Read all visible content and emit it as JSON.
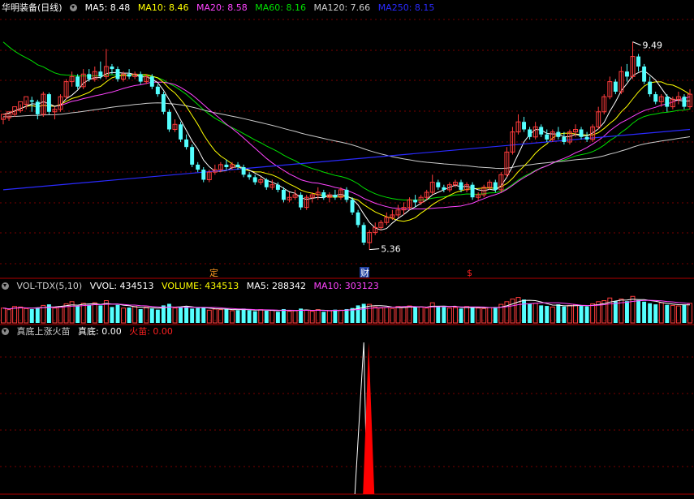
{
  "colors": {
    "up": "#ff3c3c",
    "down": "#54ffff",
    "ma5": "#ffffff",
    "ma10": "#ffff00",
    "ma20": "#ff44ff",
    "ma60": "#00e000",
    "ma120": "#cccccc",
    "ma250": "#2a2aff",
    "grid": "#7a0000",
    "axis": "#b00000"
  },
  "header_price": {
    "stock": "华明装备",
    "period": "(日线)",
    "ma5": "MA5: 8.48",
    "ma10": "MA10: 8.46",
    "ma20": "MA20: 8.58",
    "ma60": "MA60: 8.16",
    "ma120": "MA120: 7.66",
    "ma250": "MA250: 8.15"
  },
  "header_volume": {
    "name": "VOL-TDX(5,10)",
    "vvol": "VVOL: 434513",
    "volume": "VOLUME: 434513",
    "ma5": "MA5: 288342",
    "ma10": "MA10: 303123"
  },
  "header_indicator": {
    "name": "真底上涨火苗",
    "zhendi": "真底: 0.00",
    "huomiao": "火苗: 0.00"
  },
  "markers": {
    "ding": "定",
    "cai": "财",
    "dollar": "$"
  },
  "chart_data": [
    {
      "type": "candlestick",
      "title": "华明装备 (日线)",
      "annotations": [
        {
          "label": "9.49",
          "kind": "high"
        },
        {
          "label": "5.36",
          "kind": "low"
        }
      ],
      "ylim": [
        5.0,
        10.0
      ],
      "candles": [
        [
          7.95,
          8.05,
          8.0,
          7.85
        ],
        [
          7.98,
          8.1,
          8.06,
          7.92
        ],
        [
          8.05,
          8.2,
          8.14,
          8.0
        ],
        [
          8.12,
          8.3,
          8.25,
          8.08
        ],
        [
          8.25,
          8.4,
          8.33,
          8.15
        ],
        [
          8.33,
          8.3,
          8.4,
          8.1
        ],
        [
          8.3,
          8.05,
          8.34,
          7.95
        ],
        [
          8.05,
          8.45,
          8.5,
          8.0
        ],
        [
          8.45,
          8.1,
          8.48,
          8.05
        ],
        [
          8.1,
          8.15,
          8.2,
          7.95
        ],
        [
          8.15,
          8.4,
          8.45,
          8.1
        ],
        [
          8.4,
          8.7,
          8.75,
          8.35
        ],
        [
          8.7,
          8.8,
          8.9,
          8.6
        ],
        [
          8.8,
          8.6,
          8.85,
          8.55
        ],
        [
          8.6,
          8.85,
          8.95,
          8.55
        ],
        [
          8.85,
          8.75,
          8.95,
          8.7
        ],
        [
          8.75,
          8.9,
          9.0,
          8.7
        ],
        [
          8.9,
          8.8,
          9.1,
          8.75
        ],
        [
          8.8,
          9.0,
          9.35,
          8.75
        ],
        [
          9.0,
          8.95,
          9.05,
          8.85
        ],
        [
          8.95,
          8.75,
          9.0,
          8.7
        ],
        [
          8.75,
          8.85,
          8.9,
          8.7
        ],
        [
          8.85,
          8.8,
          8.95,
          8.75
        ],
        [
          8.8,
          8.85,
          8.9,
          8.75
        ],
        [
          8.85,
          8.7,
          8.9,
          8.65
        ],
        [
          8.7,
          8.8,
          8.85,
          8.65
        ],
        [
          8.8,
          8.6,
          8.85,
          8.55
        ],
        [
          8.6,
          8.45,
          8.65,
          8.4
        ],
        [
          8.45,
          8.1,
          8.5,
          8.05
        ],
        [
          8.1,
          7.75,
          8.15,
          7.7
        ],
        [
          7.75,
          7.85,
          7.95,
          7.7
        ],
        [
          7.85,
          7.55,
          7.9,
          7.5
        ],
        [
          7.55,
          7.4,
          7.65,
          7.35
        ],
        [
          7.4,
          7.05,
          7.45,
          7.0
        ],
        [
          7.05,
          6.95,
          7.1,
          6.9
        ],
        [
          6.95,
          6.75,
          7.0,
          6.7
        ],
        [
          6.75,
          6.9,
          6.95,
          6.7
        ],
        [
          6.9,
          6.95,
          7.05,
          6.85
        ],
        [
          6.95,
          7.05,
          7.1,
          6.9
        ],
        [
          7.05,
          7.0,
          7.15,
          6.95
        ],
        [
          7.0,
          7.05,
          7.1,
          6.95
        ],
        [
          7.05,
          7.0,
          7.1,
          6.95
        ],
        [
          7.0,
          6.85,
          7.05,
          6.8
        ],
        [
          6.85,
          6.8,
          6.9,
          6.75
        ],
        [
          6.8,
          6.7,
          6.85,
          6.65
        ],
        [
          6.7,
          6.75,
          6.8,
          6.65
        ],
        [
          6.75,
          6.6,
          6.78,
          6.55
        ],
        [
          6.6,
          6.65,
          6.75,
          6.55
        ],
        [
          6.65,
          6.55,
          6.7,
          6.5
        ],
        [
          6.55,
          6.35,
          6.6,
          6.3
        ],
        [
          6.35,
          6.4,
          6.5,
          6.3
        ],
        [
          6.4,
          6.45,
          6.55,
          6.35
        ],
        [
          6.45,
          6.2,
          6.5,
          6.15
        ],
        [
          6.2,
          6.4,
          6.45,
          6.15
        ],
        [
          6.4,
          6.45,
          6.5,
          6.3
        ],
        [
          6.45,
          6.5,
          6.6,
          6.35
        ],
        [
          6.5,
          6.4,
          6.55,
          6.35
        ],
        [
          6.4,
          6.45,
          6.5,
          6.3
        ],
        [
          6.45,
          6.4,
          6.55,
          6.35
        ],
        [
          6.4,
          6.55,
          6.6,
          6.35
        ],
        [
          6.55,
          6.35,
          6.6,
          6.3
        ],
        [
          6.35,
          6.1,
          6.4,
          6.05
        ],
        [
          6.1,
          5.85,
          6.15,
          5.8
        ],
        [
          5.85,
          5.5,
          5.9,
          5.45
        ],
        [
          5.5,
          5.7,
          5.75,
          5.36
        ],
        [
          5.7,
          5.8,
          5.9,
          5.65
        ],
        [
          5.8,
          5.9,
          5.95,
          5.75
        ],
        [
          5.9,
          6.0,
          6.1,
          5.85
        ],
        [
          6.0,
          6.05,
          6.15,
          5.95
        ],
        [
          6.05,
          6.15,
          6.25,
          6.0
        ],
        [
          6.15,
          6.2,
          6.3,
          6.05
        ],
        [
          6.2,
          6.35,
          6.4,
          6.15
        ],
        [
          6.35,
          6.3,
          6.45,
          6.2
        ],
        [
          6.3,
          6.4,
          6.45,
          6.25
        ],
        [
          6.4,
          6.5,
          6.55,
          6.35
        ],
        [
          6.5,
          6.7,
          6.85,
          6.45
        ],
        [
          6.7,
          6.6,
          6.75,
          6.55
        ],
        [
          6.6,
          6.55,
          6.65,
          6.5
        ],
        [
          6.55,
          6.65,
          6.7,
          6.5
        ],
        [
          6.65,
          6.7,
          6.75,
          6.6
        ],
        [
          6.7,
          6.55,
          6.75,
          6.5
        ],
        [
          6.55,
          6.65,
          6.7,
          6.5
        ],
        [
          6.65,
          6.4,
          6.7,
          6.35
        ],
        [
          6.4,
          6.45,
          6.5,
          6.35
        ],
        [
          6.45,
          6.6,
          6.65,
          6.4
        ],
        [
          6.6,
          6.7,
          6.75,
          6.55
        ],
        [
          6.7,
          6.55,
          6.75,
          6.5
        ],
        [
          6.55,
          6.85,
          6.9,
          6.5
        ],
        [
          6.85,
          7.3,
          7.4,
          6.8
        ],
        [
          7.3,
          7.7,
          7.8,
          7.25
        ],
        [
          7.7,
          7.9,
          8.05,
          7.65
        ],
        [
          7.9,
          7.75,
          8.0,
          7.7
        ],
        [
          7.75,
          7.6,
          7.8,
          7.55
        ],
        [
          7.6,
          7.8,
          7.9,
          7.55
        ],
        [
          7.8,
          7.65,
          7.85,
          7.6
        ],
        [
          7.65,
          7.55,
          7.75,
          7.5
        ],
        [
          7.55,
          7.7,
          7.75,
          7.5
        ],
        [
          7.7,
          7.6,
          7.8,
          7.55
        ],
        [
          7.6,
          7.5,
          7.7,
          7.45
        ],
        [
          7.5,
          7.7,
          7.75,
          7.45
        ],
        [
          7.7,
          7.75,
          7.85,
          7.6
        ],
        [
          7.75,
          7.6,
          7.8,
          7.55
        ],
        [
          7.6,
          7.55,
          7.7,
          7.5
        ],
        [
          7.55,
          7.8,
          7.85,
          7.5
        ],
        [
          7.8,
          8.1,
          8.2,
          7.75
        ],
        [
          8.1,
          8.4,
          8.45,
          8.05
        ],
        [
          8.4,
          8.7,
          8.8,
          8.35
        ],
        [
          8.7,
          8.5,
          8.75,
          8.45
        ],
        [
          8.5,
          8.9,
          9.0,
          8.45
        ],
        [
          8.9,
          8.8,
          9.05,
          8.7
        ],
        [
          8.8,
          9.2,
          9.49,
          8.75
        ],
        [
          9.2,
          9.0,
          9.25,
          8.9
        ],
        [
          9.0,
          8.7,
          9.05,
          8.65
        ],
        [
          8.7,
          8.45,
          8.8,
          8.4
        ],
        [
          8.45,
          8.3,
          8.5,
          8.25
        ],
        [
          8.3,
          8.4,
          8.45,
          8.2
        ],
        [
          8.4,
          8.2,
          8.45,
          8.1
        ],
        [
          8.2,
          8.35,
          8.4,
          8.15
        ],
        [
          8.35,
          8.4,
          8.5,
          8.25
        ],
        [
          8.4,
          8.2,
          8.45,
          8.15
        ],
        [
          8.2,
          8.45,
          8.55,
          8.15
        ]
      ],
      "ma250_endpoints": [
        6.55,
        7.75
      ]
    },
    {
      "type": "bar",
      "title": "VOL-TDX(5,10)",
      "values": [
        28,
        25,
        31,
        30,
        27,
        26,
        29,
        33,
        35,
        28,
        31,
        36,
        40,
        32,
        37,
        34,
        38,
        33,
        42,
        30,
        34,
        28,
        29,
        31,
        26,
        30,
        27,
        25,
        33,
        36,
        28,
        30,
        31,
        27,
        28,
        29,
        24,
        26,
        25,
        27,
        23,
        24,
        27,
        24,
        22,
        25,
        23,
        24,
        21,
        26,
        22,
        23,
        27,
        24,
        22,
        25,
        21,
        23,
        25,
        24,
        26,
        28,
        33,
        36,
        35,
        30,
        28,
        29,
        27,
        31,
        30,
        32,
        29,
        30,
        28,
        38,
        32,
        30,
        28,
        29,
        27,
        31,
        30,
        28,
        27,
        29,
        30,
        35,
        40,
        45,
        48,
        44,
        36,
        37,
        33,
        32,
        30,
        35,
        31,
        33,
        34,
        32,
        31,
        36,
        40,
        42,
        47,
        41,
        45,
        41,
        50,
        43,
        40,
        37,
        35,
        38,
        34,
        33,
        32,
        34,
        37
      ],
      "ma5_series": "derived",
      "ma10_series": "derived"
    },
    {
      "type": "area",
      "title": "真底上涨火苗",
      "series": [
        {
          "name": "真底",
          "values": [
            1.0
          ]
        },
        {
          "name": "火苗",
          "values": [
            1.0
          ]
        }
      ]
    }
  ]
}
